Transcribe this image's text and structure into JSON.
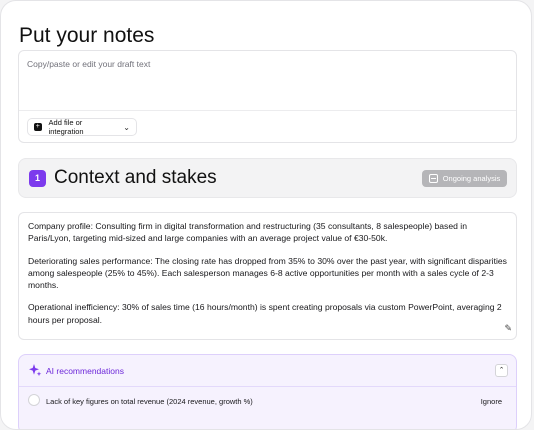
{
  "notes": {
    "title": "Put your notes",
    "placeholder": "Copy/paste or edit your draft text",
    "add_button_label": "Add file or integration"
  },
  "section": {
    "number": "1",
    "title": "Context and stakes",
    "status_label": "Ongoing analysis",
    "paragraphs": [
      "Company profile: Consulting firm in digital transformation and restructuring (35 consultants, 8 salespeople) based in Paris/Lyon, targeting mid-sized and large companies with an average project value of €30-50k.",
      "Deteriorating sales performance: The closing rate has dropped from 35% to 30% over the past year, with significant disparities among salespeople (25% to 45%). Each salesperson manages 6-8 active opportunities per month with a sales cycle of 2-3 months.",
      "Operational inefficiency: 30% of sales time (16 hours/month) is spent creating proposals via custom PowerPoint, averaging 2 hours per proposal."
    ]
  },
  "ai": {
    "title": "AI recommendations",
    "recommendations": [
      {
        "text": "Lack of key figures on total revenue (2024 revenue, growth %)",
        "action": "Ignore"
      }
    ]
  },
  "colors": {
    "accent": "#7c3aed",
    "ai_panel_bg": "#f6f2fe",
    "status_badge_bg": "#b5b5b8"
  },
  "icons": {
    "add": "plus-square-icon",
    "dropdown": "chevron-down-icon",
    "status": "spreadsheet-icon",
    "corner": "edit-icon",
    "ai": "sparkles-icon",
    "collapse": "chevron-up-icon"
  }
}
